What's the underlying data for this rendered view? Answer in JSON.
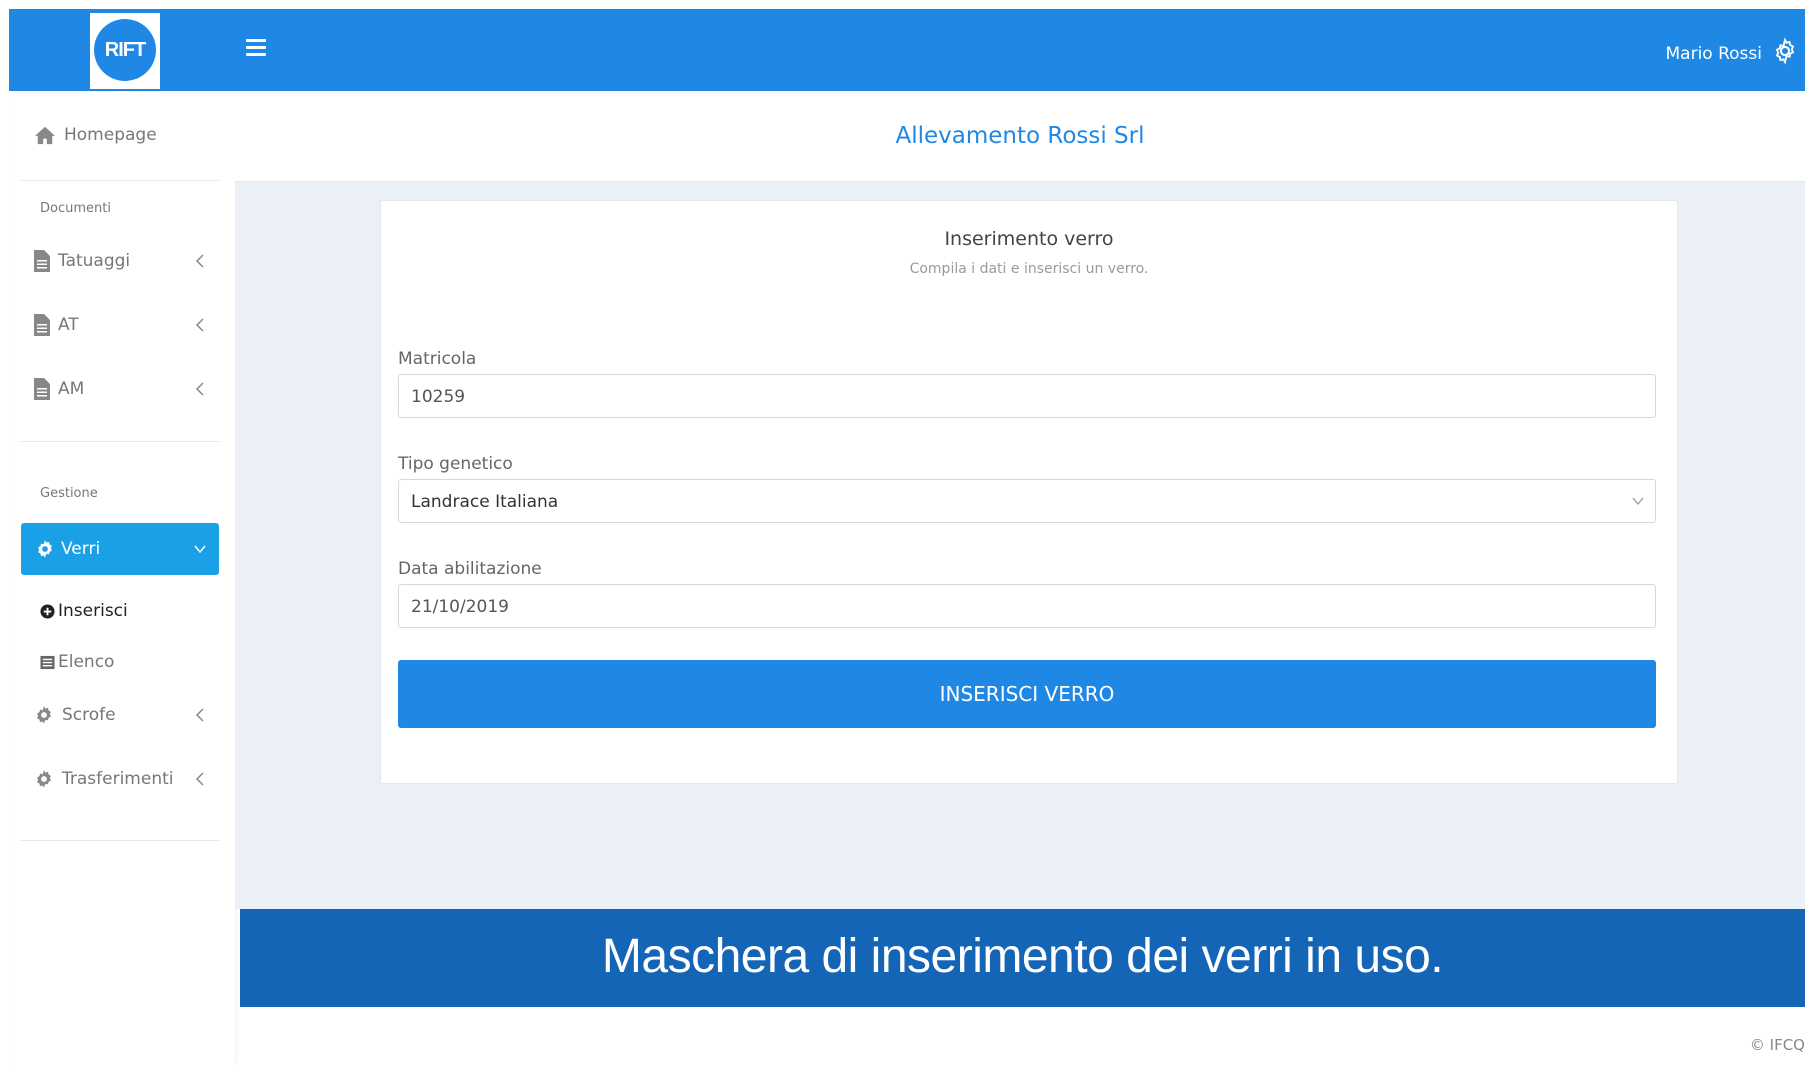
{
  "header": {
    "logo_text": "RIFT",
    "user_name": "Mario Rossi",
    "menu_icon": "hamburger-icon",
    "settings_icon": "gear-icon"
  },
  "sidebar": {
    "homepage": "Homepage",
    "section_documents": "Documenti",
    "doc_items": [
      "Tatuaggi",
      "AT",
      "AM"
    ],
    "section_management": "Gestione",
    "active_item": "Verri",
    "sub_items": [
      "Inserisci",
      "Elenco"
    ],
    "other_items": [
      "Scrofe",
      "Trasferimenti"
    ]
  },
  "page": {
    "company": "Allevamento Rossi Srl",
    "form_title": "Inserimento verro",
    "form_subtitle": "Compila i dati e inserisci un verro.",
    "fields": {
      "matricola_label": "Matricola",
      "matricola_value": "10259",
      "tipo_label": "Tipo genetico",
      "tipo_value": "Landrace Italiana",
      "data_label": "Data abilitazione",
      "data_value": "21/10/2019"
    },
    "submit_label": "INSERISCI VERRO"
  },
  "caption": "Maschera di inserimento dei verri in uso.",
  "footer": "© IFCQ",
  "colors": {
    "primary": "#1f88e5",
    "active": "#1aa0e6",
    "banner": "#1565b7",
    "background": "#ebf0f6"
  }
}
